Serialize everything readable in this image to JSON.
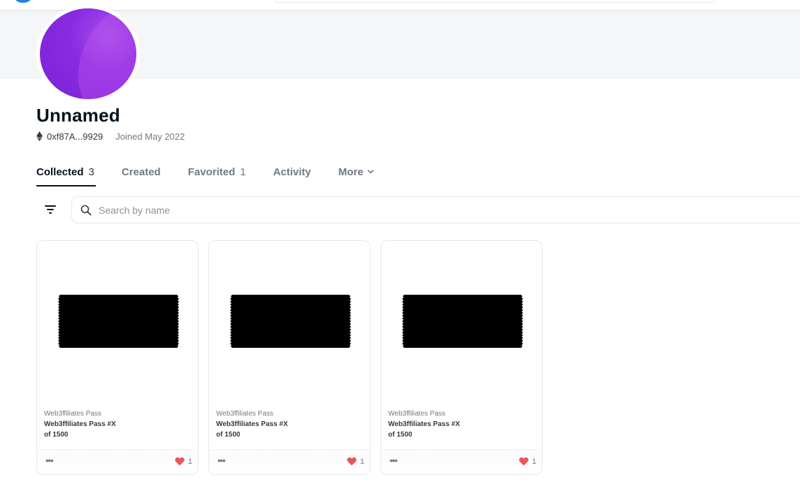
{
  "profile": {
    "name": "Unnamed",
    "address": "0xf87A...9929",
    "joined": "Joined May 2022"
  },
  "tabs": [
    {
      "label": "Collected",
      "count": "3"
    },
    {
      "label": "Created",
      "count": ""
    },
    {
      "label": "Favorited",
      "count": "1"
    },
    {
      "label": "Activity",
      "count": ""
    },
    {
      "label": "More",
      "count": ""
    }
  ],
  "search": {
    "placeholder": "Search by name"
  },
  "cards": [
    {
      "collection": "Web3ffiliates Pass",
      "name": "Web3ffiliates Pass #X",
      "edition": "of 1500",
      "likes": "1",
      "more": "•••"
    },
    {
      "collection": "Web3ffiliates Pass",
      "name": "Web3ffiliates Pass #X",
      "edition": "of 1500",
      "likes": "1",
      "more": "•••"
    },
    {
      "collection": "Web3ffiliates Pass",
      "name": "Web3ffiliates Pass #X",
      "edition": "of 1500",
      "likes": "1",
      "more": "•••"
    }
  ],
  "icons": {
    "eth": "ethereum-icon",
    "filter": "filter-icon",
    "search": "search-icon",
    "heart": "heart-icon",
    "chevron": "chevron-down-icon"
  },
  "colors": {
    "avatar": "#8a2be2",
    "heart": "#eb5757",
    "text_primary": "#04111d",
    "text_secondary": "#707a83"
  }
}
